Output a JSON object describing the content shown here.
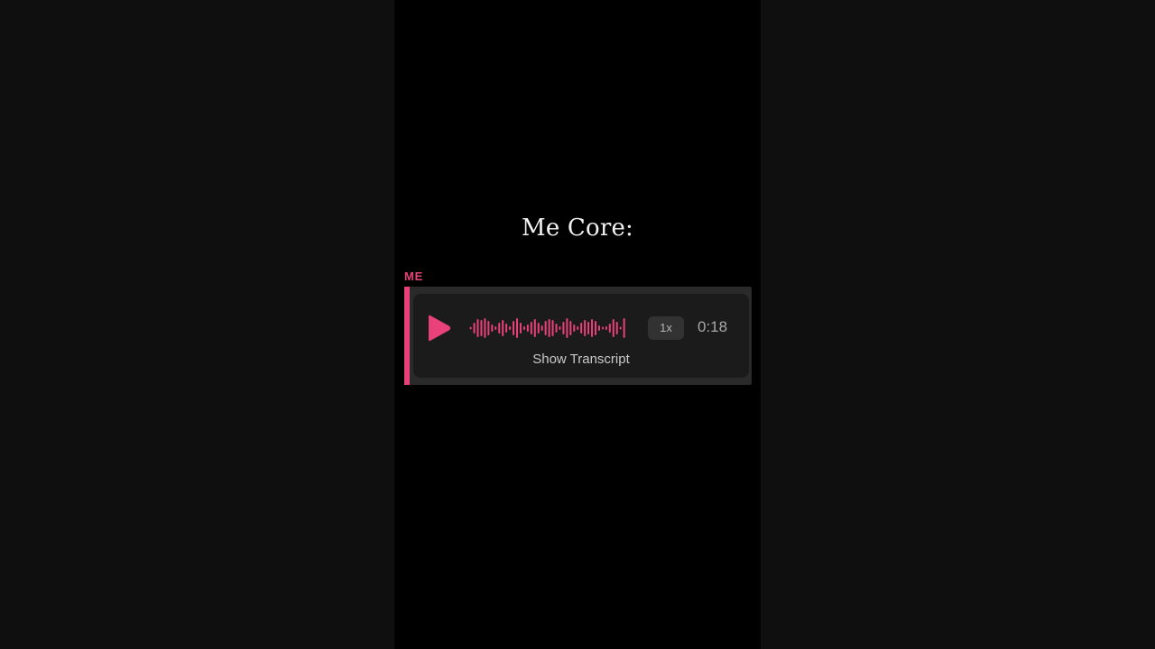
{
  "caption": "Me Core:",
  "message": {
    "sender": "ME",
    "speed": "1x",
    "duration": "0:18",
    "transcript_label": "Show Transcript",
    "accent_color": "#e9417a",
    "play_icon": "play-icon"
  }
}
